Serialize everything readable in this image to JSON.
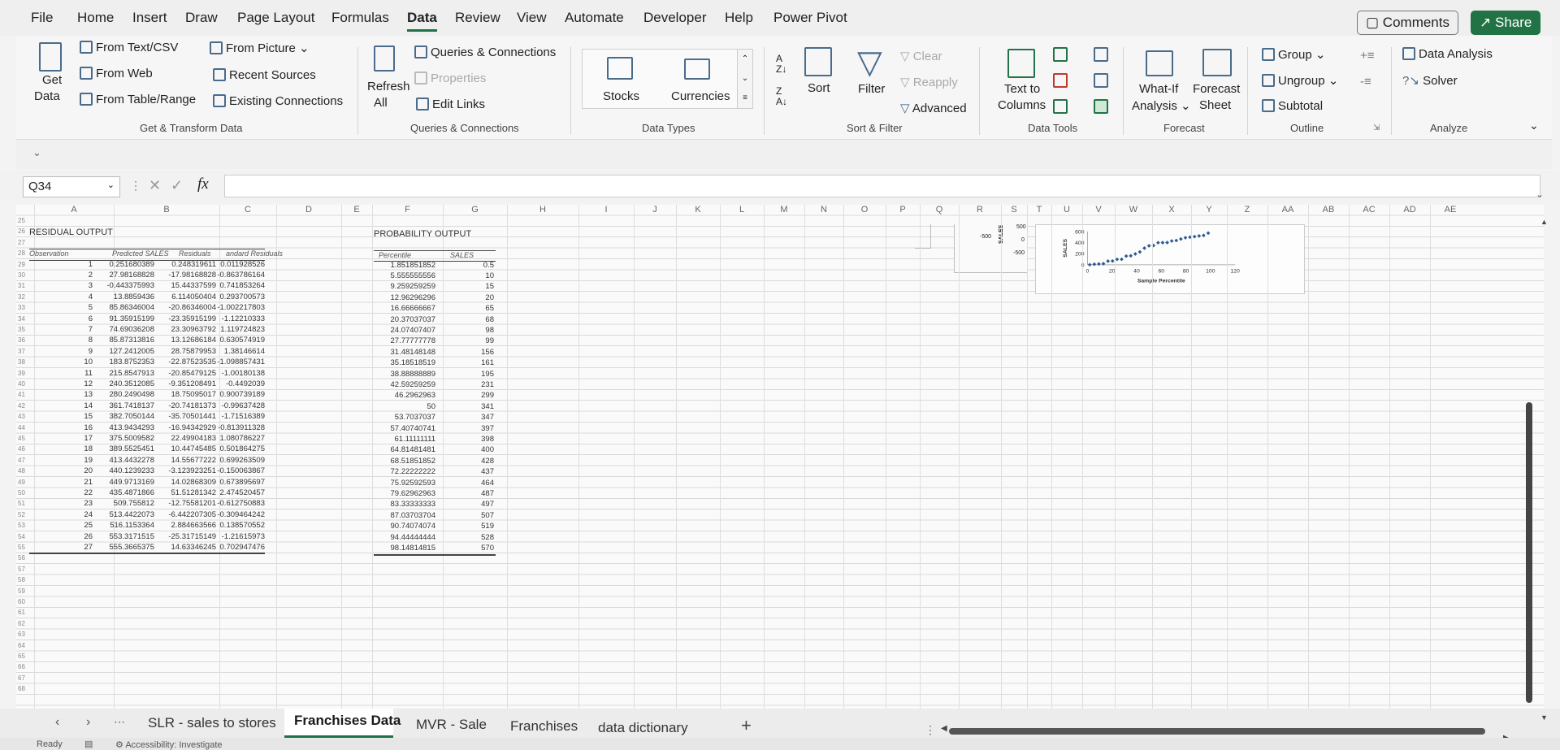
{
  "menu": [
    "File",
    "Home",
    "Insert",
    "Draw",
    "Page Layout",
    "Formulas",
    "Data",
    "Review",
    "View",
    "Automate",
    "Developer",
    "Help",
    "Power Pivot"
  ],
  "topbar": {
    "comments": "Comments",
    "share": "Share"
  },
  "ribbon": {
    "get_data": "Get",
    "get_data2": "Data",
    "from_text": "From Text/CSV",
    "from_web": "From Web",
    "from_table": "From Table/Range",
    "from_picture": "From Picture",
    "recent_sources": "Recent Sources",
    "existing_connections": "Existing Connections",
    "group_get": "Get & Transform Data",
    "refresh": "Refresh",
    "refresh2": "All",
    "queries": "Queries & Connections",
    "properties": "Properties",
    "edit_links": "Edit Links",
    "group_queries": "Queries & Connections",
    "stocks": "Stocks",
    "currencies": "Currencies",
    "group_types": "Data Types",
    "sort": "Sort",
    "filter": "Filter",
    "clear": "Clear",
    "reapply": "Reapply",
    "advanced": "Advanced",
    "group_sort": "Sort & Filter",
    "text_to": "Text to",
    "columns": "Columns",
    "group_tools": "Data Tools",
    "whatif": "What-If",
    "analysis": "Analysis",
    "forecast": "Forecast",
    "sheet": "Sheet",
    "group_forecast": "Forecast",
    "group": "Group",
    "ungroup": "Ungroup",
    "subtotal": "Subtotal",
    "group_outline": "Outline",
    "data_analysis": "Data Analysis",
    "solver": "Solver",
    "group_analyze": "Analyze"
  },
  "formula": {
    "namebox": "Q34"
  },
  "columns": [
    "A",
    "B",
    "C",
    "D",
    "E",
    "F",
    "G",
    "H",
    "I",
    "J",
    "K",
    "L",
    "M",
    "N",
    "O",
    "P",
    "Q",
    "R",
    "S",
    "T",
    "U",
    "V",
    "W",
    "X",
    "Y",
    "Z",
    "AA",
    "AB",
    "AC",
    "AD",
    "AE"
  ],
  "rows": [
    "25",
    "26",
    "27",
    "28",
    "29",
    "30",
    "31",
    "32",
    "33",
    "34",
    "35",
    "36",
    "37",
    "38",
    "39",
    "40",
    "41",
    "42",
    "43",
    "44",
    "45",
    "46",
    "47",
    "48",
    "49",
    "50",
    "51",
    "52",
    "53",
    "54",
    "55",
    "56",
    "57",
    "58",
    "59",
    "60",
    "61",
    "62",
    "63",
    "64",
    "65",
    "66",
    "67",
    "68"
  ],
  "residual": {
    "title": "RESIDUAL OUTPUT",
    "headers": [
      "Observation",
      "Predicted SALES",
      "Residuals",
      "andard Residuals"
    ],
    "obs": [
      "1",
      "2",
      "3",
      "4",
      "5",
      "6",
      "7",
      "8",
      "9",
      "10",
      "11",
      "12",
      "13",
      "14",
      "15",
      "16",
      "17",
      "18",
      "19",
      "20",
      "21",
      "22",
      "23",
      "24",
      "25",
      "26",
      "27"
    ],
    "pred": [
      "0.251680389",
      "27.98168828",
      "-0.443375993",
      "13.8859436",
      "85.86346004",
      "91.35915199",
      "74.69036208",
      "85.87313816",
      "127.2412005",
      "183.8752353",
      "215.8547913",
      "240.3512085",
      "280.2490498",
      "361.7418137",
      "382.7050144",
      "413.9434293",
      "375.5009582",
      "389.5525451",
      "413.4432278",
      "440.1239233",
      "449.9713169",
      "435.4871866",
      "509.755812",
      "513.4422073",
      "516.1153364",
      "553.3171515",
      "555.3665375"
    ],
    "resid": [
      "0.248319611",
      "-17.98168828",
      "15.44337599",
      "6.114050404",
      "-20.86346004",
      "-23.35915199",
      "23.30963792",
      "13.12686184",
      "28.75879953",
      "-22.87523535",
      "-20.85479125",
      "-9.351208491",
      "18.75095017",
      "-20.74181373",
      "-35.70501441",
      "-16.94342929",
      "22.49904183",
      "10.44745485",
      "14.55677222",
      "-3.123923251",
      "14.02868309",
      "51.51281342",
      "-12.75581201",
      "-6.442207305",
      "2.884663566",
      "-25.31715149",
      "14.63346245"
    ],
    "std": [
      "0.011928526",
      "-0.863786164",
      "0.741853264",
      "0.293700573",
      "-1.002217803",
      "-1.12210333",
      "1.119724823",
      "0.630574919",
      "1.38146614",
      "-1.098857431",
      "-1.00180138",
      "-0.4492039",
      "0.900739189",
      "-0.99637428",
      "-1.71516389",
      "-0.813911328",
      "1.080786227",
      "0.501864275",
      "0.699263509",
      "-0.150063867",
      "0.673895697",
      "2.474520457",
      "-0.612750883",
      "-0.309464242",
      "0.138570552",
      "-1.21615973",
      "0.702947476"
    ]
  },
  "probability": {
    "title": "PROBABILITY OUTPUT",
    "headers": [
      "Percentile",
      "SALES"
    ],
    "pct": [
      "1.851851852",
      "5.555555556",
      "9.259259259",
      "12.96296296",
      "16.66666667",
      "20.37037037",
      "24.07407407",
      "27.77777778",
      "31.48148148",
      "35.18518519",
      "38.88888889",
      "42.59259259",
      "46.2962963",
      "50",
      "53.7037037",
      "57.40740741",
      "61.11111111",
      "64.81481481",
      "68.51851852",
      "72.22222222",
      "75.92592593",
      "79.62962963",
      "83.33333333",
      "87.03703704",
      "90.74074074",
      "94.44444444",
      "98.14814815"
    ],
    "sales": [
      "0.5",
      "10",
      "15",
      "20",
      "65",
      "68",
      "98",
      "99",
      "156",
      "161",
      "195",
      "231",
      "299",
      "341",
      "347",
      "397",
      "398",
      "400",
      "428",
      "437",
      "464",
      "487",
      "497",
      "507",
      "519",
      "528",
      "570"
    ]
  },
  "chart_data": {
    "type": "scatter",
    "xlabel": "Sample Percentile",
    "ylabel": "SALES",
    "xlim": [
      0,
      120
    ],
    "ylim": [
      0,
      600
    ],
    "xticks": [
      "0",
      "20",
      "40",
      "60",
      "80",
      "100",
      "120"
    ],
    "yticks": [
      "0",
      "200",
      "400",
      "600"
    ],
    "color": "#2e5a93",
    "x": [
      1.85,
      5.56,
      9.26,
      12.96,
      16.67,
      20.37,
      24.07,
      27.78,
      31.48,
      35.19,
      38.89,
      42.59,
      46.3,
      50,
      53.7,
      57.41,
      61.11,
      64.81,
      68.52,
      72.22,
      75.93,
      79.63,
      83.33,
      87.04,
      90.74,
      94.44,
      98.15
    ],
    "y": [
      0.5,
      10,
      15,
      20,
      65,
      68,
      98,
      99,
      156,
      161,
      195,
      231,
      299,
      341,
      347,
      397,
      398,
      400,
      428,
      437,
      464,
      487,
      497,
      507,
      519,
      528,
      570
    ]
  },
  "partial_chart": {
    "ylabel": "SALES",
    "ticks": [
      "500",
      "0",
      "-500"
    ],
    "left_tick": "-500"
  },
  "tabs": [
    "SLR - sales to stores",
    "Franchises Data",
    "MVR - Sale",
    "Franchises",
    "data dictionary"
  ],
  "status": {
    "ready": "Ready",
    "accessibility": "Accessibility: Investigate"
  }
}
